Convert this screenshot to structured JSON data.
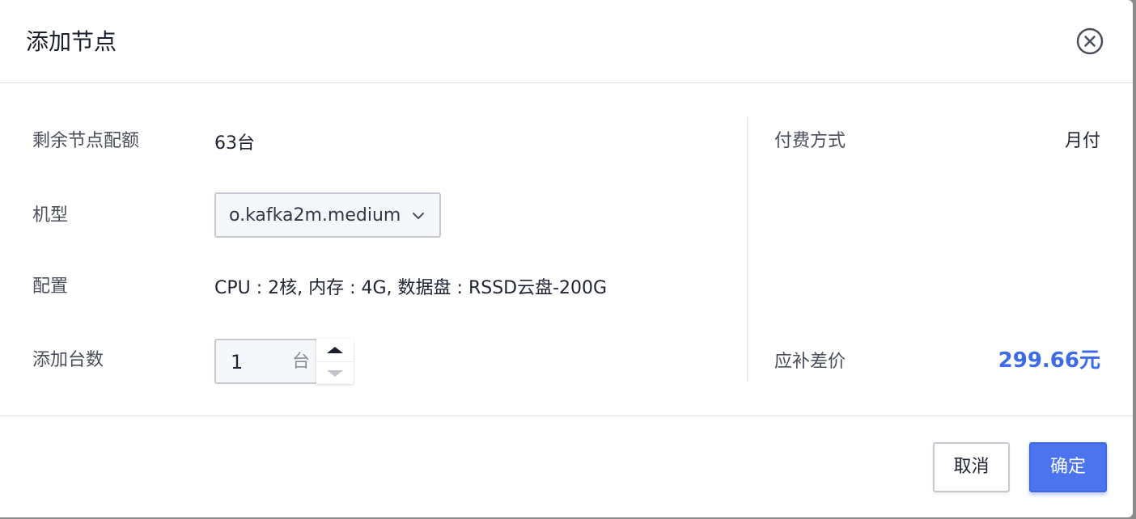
{
  "dialog": {
    "title": "添加节点"
  },
  "form": {
    "remaining_quota_label": "剩余节点配额",
    "remaining_quota_value": "63台",
    "machine_type_label": "机型",
    "machine_type_value": "o.kafka2m.medium",
    "config_label": "配置",
    "config_value": "CPU : 2核, 内存 : 4G, 数据盘 : RSSD云盘-200G",
    "add_count_label": "添加台数",
    "add_count_value": "1",
    "add_count_unit": "台"
  },
  "summary": {
    "payment_label": "付费方式",
    "payment_value": "月付",
    "price_diff_label": "应补差价",
    "price_diff_value": "299.66元"
  },
  "footer": {
    "cancel_label": "取消",
    "confirm_label": "确定"
  },
  "icons": {
    "close": "close-circle-icon",
    "select_arrow": "chevron-down-icon",
    "increment": "caret-up-icon",
    "decrement": "caret-down-icon"
  },
  "colors": {
    "accent": "#4b74ee",
    "price": "#3d6ae8"
  }
}
